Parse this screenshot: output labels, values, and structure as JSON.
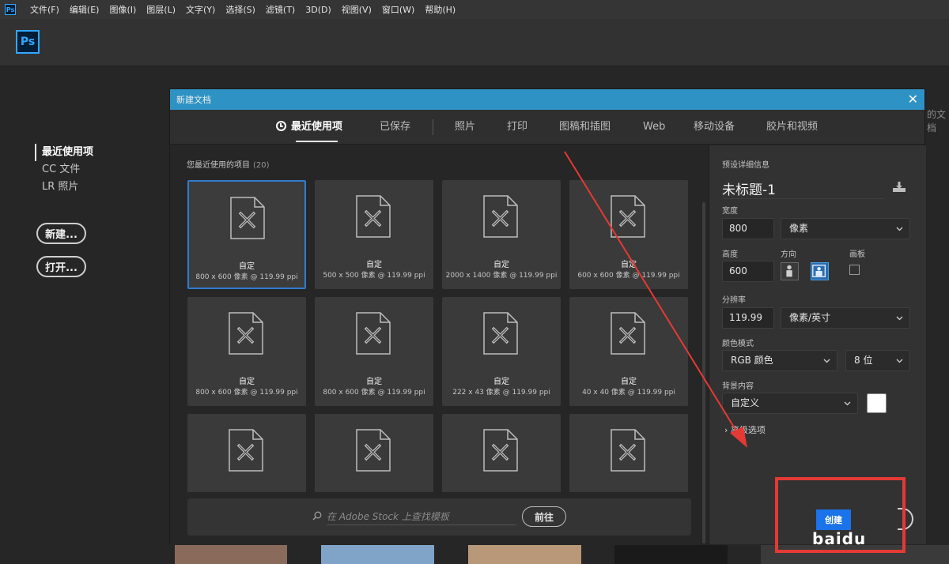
{
  "menu": {
    "app_icon": "Ps",
    "items": [
      "文件(F)",
      "编辑(E)",
      "图像(I)",
      "图层(L)",
      "文字(Y)",
      "选择(S)",
      "滤镜(T)",
      "3D(D)",
      "视图(V)",
      "窗口(W)",
      "帮助(H)"
    ]
  },
  "header": {
    "logo": "Ps"
  },
  "start": {
    "nav": [
      "最近使用项",
      "CC 文件",
      "LR 照片"
    ],
    "new_button": "新建...",
    "open_button": "打开...",
    "behind_text": "的文档"
  },
  "dialog": {
    "title": "新建文档",
    "tabs": [
      "最近使用项",
      "已保存",
      "照片",
      "打印",
      "图稿和插图",
      "Web",
      "移动设备",
      "胶片和视频"
    ],
    "recent": {
      "title": "您最近使用的项目",
      "count": "(20)",
      "cards": [
        {
          "name": "自定",
          "meta": "800 x 600 像素 @ 119.99 ppi"
        },
        {
          "name": "自定",
          "meta": "500 x 500 像素 @ 119.99 ppi"
        },
        {
          "name": "自定",
          "meta": "2000 x 1400 像素 @ 119.99 ppi"
        },
        {
          "name": "自定",
          "meta": "600 x 600 像素 @ 119.99 ppi"
        },
        {
          "name": "自定",
          "meta": "800 x 600 像素 @ 119.99 ppi"
        },
        {
          "name": "自定",
          "meta": "800 x 600 像素 @ 119.99 ppi"
        },
        {
          "name": "自定",
          "meta": "222 x 43 像素 @ 119.99 ppi"
        },
        {
          "name": "自定",
          "meta": "40 x 40 像素 @ 119.99 ppi"
        },
        {
          "name": "",
          "meta": ""
        },
        {
          "name": "",
          "meta": ""
        },
        {
          "name": "",
          "meta": ""
        },
        {
          "name": "",
          "meta": ""
        }
      ]
    },
    "search": {
      "placeholder": "在 Adobe Stock 上查找模板",
      "go_button": "前往"
    },
    "details": {
      "section_title": "预设详细信息",
      "preset_name": "未标题-1",
      "width_label": "宽度",
      "width_value": "800",
      "width_unit": "像素",
      "height_label": "高度",
      "height_value": "600",
      "orientation_label": "方向",
      "artboard_label": "画板",
      "resolution_label": "分辨率",
      "resolution_value": "119.99",
      "resolution_unit": "像素/英寸",
      "color_mode_label": "颜色模式",
      "color_mode_value": "RGB 颜色",
      "bit_depth_value": "8 位",
      "background_label": "背景内容",
      "background_value": "自定义",
      "background_color": "#ffffff",
      "advanced_options": "高级选项",
      "create_button": "创建",
      "watermark": "baidu"
    }
  },
  "annotation": {
    "color": "#e53935"
  }
}
